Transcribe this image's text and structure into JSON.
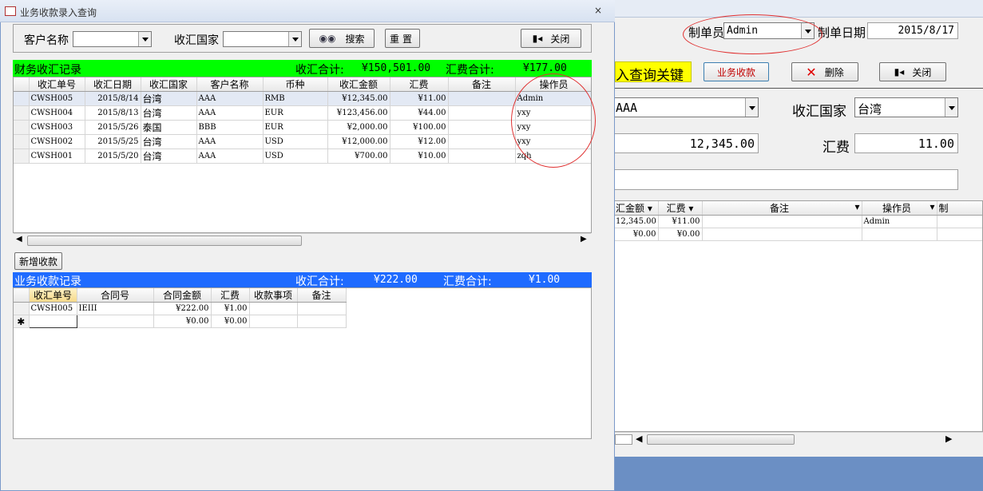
{
  "bg": {
    "maker_label": "制单员",
    "maker_value": "Admin",
    "date_label": "制单日期",
    "date_value": "2015/8/17",
    "hint_text": "入查询关键",
    "btn_business": "业务收款",
    "btn_delete": "删除",
    "btn_close": "关闭",
    "customer_value": "AAA",
    "country_label": "收汇国家",
    "country_value": "台湾",
    "amount_value": "12,345.00",
    "fee_label": "汇费",
    "fee_value": "11.00",
    "grid": {
      "headers": [
        "汇金额",
        "汇费",
        "备注",
        "操作员",
        "制"
      ],
      "rows": [
        [
          "12,345.00",
          "¥11.00",
          "",
          "Admin",
          ""
        ],
        [
          "¥0.00",
          "¥0.00",
          "",
          "",
          ""
        ]
      ]
    }
  },
  "dialog": {
    "title": "业务收款录入查询",
    "customer_label": "客户名称",
    "country_label": "收汇国家",
    "search_label": "搜索",
    "reset_label": "重置",
    "close_label": "关闭",
    "finance": {
      "title": "财务收汇记录",
      "total_label": "收汇合计:",
      "total_value": "¥150,501.00",
      "fee_label": "汇费合计:",
      "fee_value": "¥177.00",
      "headers": [
        "收汇单号",
        "收汇日期",
        "收汇国家",
        "客户名称",
        "币种",
        "收汇金额",
        "汇费",
        "备注",
        "操作员"
      ],
      "rows": [
        [
          "CWSH005",
          "2015/8/14",
          "台湾",
          "AAA",
          "RMB",
          "¥12,345.00",
          "¥11.00",
          "",
          "Admin"
        ],
        [
          "CWSH004",
          "2015/8/13",
          "台湾",
          "AAA",
          "EUR",
          "¥123,456.00",
          "¥44.00",
          "",
          "yxy"
        ],
        [
          "CWSH003",
          "2015/5/26",
          "泰国",
          "BBB",
          "EUR",
          "¥2,000.00",
          "¥100.00",
          "",
          "yxy"
        ],
        [
          "CWSH002",
          "2015/5/25",
          "台湾",
          "AAA",
          "USD",
          "¥12,000.00",
          "¥12.00",
          "",
          "yxy"
        ],
        [
          "CWSH001",
          "2015/5/20",
          "台湾",
          "AAA",
          "USD",
          "¥700.00",
          "¥10.00",
          "",
          "zqh"
        ]
      ]
    },
    "add_button": "新增收款",
    "business": {
      "title": "业务收款记录",
      "total_label": "收汇合计:",
      "total_value": "¥222.00",
      "fee_label": "汇费合计:",
      "fee_value": "¥1.00",
      "headers": [
        "收汇单号",
        "合同号",
        "合同金额",
        "汇费",
        "收款事项",
        "备注"
      ],
      "rows": [
        [
          "CWSH005",
          "IEIII",
          "¥222.00",
          "¥1.00",
          "",
          ""
        ],
        [
          "",
          "",
          "¥0.00",
          "¥0.00",
          "",
          ""
        ]
      ]
    }
  },
  "colors": {
    "finance_bar": "#00ff00",
    "business_bar": "#1f6bff",
    "hint_bg": "#ffff00",
    "annotation": "#e03030"
  }
}
